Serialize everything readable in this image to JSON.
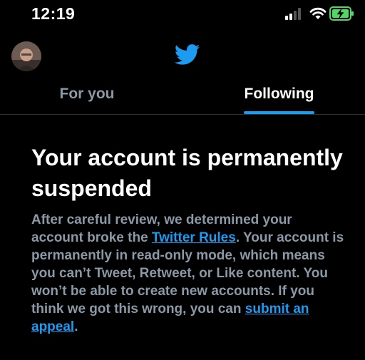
{
  "status_bar": {
    "time": "12:19",
    "icons": [
      "signal-icon",
      "wifi-icon",
      "battery-charging-icon"
    ]
  },
  "header": {
    "logo": "twitter-bird-icon",
    "avatar": "profile-avatar"
  },
  "tabs": [
    {
      "label": "For you",
      "selected": false
    },
    {
      "label": "Following",
      "selected": true
    }
  ],
  "notice": {
    "title": "Your account is permanently suspended",
    "body_part1": "After careful review, we determined your account broke the ",
    "rules_link": "Twitter Rules",
    "body_part2": ". Your account is permanently in read-only mode, which means you can’t Tweet, Retweet, or Like content. You won’t be able to create new accounts. If you think we got this wrong, you can ",
    "appeal_link": "submit an appeal",
    "body_part3": "."
  },
  "colors": {
    "background": "#000000",
    "accent": "#1d9bf0",
    "muted_text": "#8b98a5",
    "battery": "#4cd964"
  }
}
